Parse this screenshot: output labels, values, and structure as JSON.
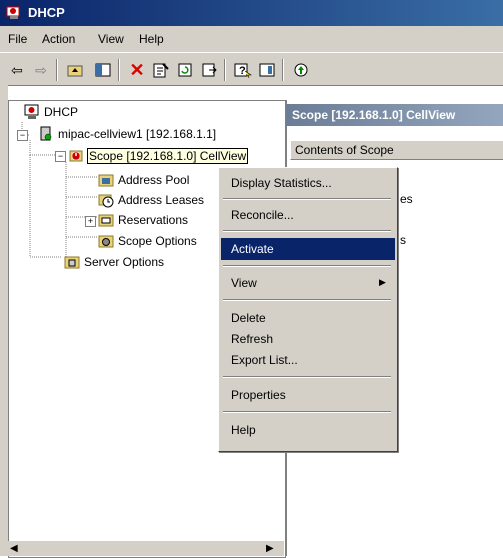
{
  "window": {
    "title": "DHCP"
  },
  "menubar": {
    "items": [
      "File",
      "Action",
      "View",
      "Help"
    ]
  },
  "toolbar": {
    "icons": [
      "back-icon",
      "forward-icon",
      "up-icon",
      "show-hide-tree-icon",
      "delete-icon",
      "properties-icon",
      "refresh-icon",
      "export-icon",
      "help-icon",
      "console-icon",
      "activate-icon"
    ]
  },
  "tree": {
    "root": "DHCP",
    "server": "mipac-cellview1 [192.168.1.1]",
    "scope": "Scope [192.168.1.0] CellView",
    "children": [
      "Address Pool",
      "Address Leases",
      "Reservations",
      "Scope Options"
    ],
    "server_options": "Server Options"
  },
  "right": {
    "header": "Scope [192.168.1.0] CellView",
    "column": "Contents of Scope",
    "partial_items": [
      "es",
      "s"
    ]
  },
  "context_menu": {
    "items": [
      "Display Statistics...",
      "Reconcile...",
      "Activate",
      "View",
      "Delete",
      "Refresh",
      "Export List...",
      "Properties",
      "Help"
    ],
    "selected": "Activate"
  },
  "colors": {
    "selection": "#0a246a",
    "chrome": "#d4d0c8",
    "tooltip": "#ffffe1"
  }
}
